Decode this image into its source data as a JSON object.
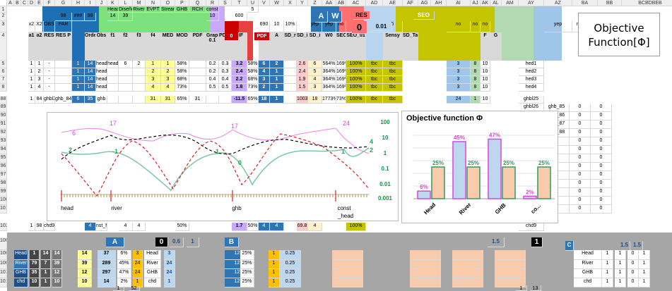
{
  "sheet": {
    "col_headers": [
      "A",
      "B",
      "C",
      "D",
      "E",
      "F",
      "G",
      "H",
      "I",
      "J",
      "K",
      "L",
      "M",
      "N",
      "O",
      "P",
      "Q",
      "R",
      "S",
      "T",
      "U",
      "V",
      "W",
      "X",
      "Y",
      "Z",
      "AA",
      "AB",
      "AC",
      "AD",
      "AE",
      "AF",
      "AG",
      "AH",
      "AI",
      "AJ",
      "AK",
      "AL",
      "AM",
      "AY",
      "AZ",
      "BA",
      "BB",
      "BCBDBEB"
    ],
    "row_headers": [
      "1",
      "2",
      "3",
      "4",
      "5",
      "6",
      "7",
      "8",
      "88",
      "89",
      "90",
      "91",
      "92",
      "93",
      "94",
      "95",
      "96",
      "97",
      "98",
      "99",
      "100",
      "101",
      "102",
      "1003",
      "1004",
      "1009",
      "1012",
      "1014"
    ],
    "header_rows": {
      "r1": [
        "",
        "",
        "",
        "",
        "",
        "",
        "",
        "Head",
        "Diseño",
        "River",
        "EVPT",
        "Streams",
        "GHB",
        "RCH",
        "const_head",
        "",
        "",
        "5",
        "",
        "",
        "",
        "",
        "",
        "",
        "",
        "",
        "",
        "",
        "",
        "",
        "",
        "",
        "",
        "",
        "",
        "",
        "",
        "",
        ""
      ],
      "r2": [
        "",
        "",
        "",
        "98",
        "###",
        "98",
        "",
        "14",
        "39",
        "",
        "",
        "",
        "",
        "",
        "10",
        "",
        "600",
        "",
        "",
        "",
        "",
        "",
        "",
        "",
        "",
        "",
        "",
        "",
        "",
        "",
        "",
        "",
        "",
        "",
        "",
        "",
        "",
        "",
        ""
      ],
      "r3": [
        "x2",
        "X2",
        "OBS",
        "PAR",
        "",
        "",
        "",
        "",
        "",
        "",
        "",
        "",
        "",
        "",
        "",
        "",
        "",
        "",
        "690",
        "10",
        "10%",
        "",
        "yep",
        "yep",
        "no",
        "yep",
        "no",
        "5",
        "",
        "",
        "",
        "no",
        "no",
        "no",
        "",
        "",
        "",
        "yep",
        "no"
      ],
      "r4": [
        "a1",
        "a2",
        "RES",
        "RES P",
        "",
        "Order",
        "Obs",
        "f1",
        "f2",
        "f3",
        "f4",
        "MED",
        "MOD",
        "PDF",
        "Graph 0.1",
        "PDFa",
        "DIF",
        "",
        "A",
        "A",
        "SD_r",
        "SD_i",
        "SD_i",
        "W0",
        "SEO",
        "SEO_01",
        "",
        "Sensy",
        "SD_Tab",
        "",
        "",
        "",
        "",
        "F",
        "G",
        "",
        "",
        ""
      ]
    },
    "top_labels": {
      "a_label": "A",
      "w_label": "W",
      "res_label": "RES",
      "seo_label": "SEO",
      "sd_label": "SD_i",
      "pdf_label": "PDF",
      "zero_val": "0",
      "yep_val": "0.01",
      "five": "5"
    },
    "rows": [
      {
        "n": "5",
        "d": "1",
        "e": "1",
        "f": "-",
        "g": "",
        "h": "1",
        "i": "14",
        "j": "head",
        "k": "head",
        "l": "6",
        "m": "2",
        "n2": "1",
        "o": "1",
        "p": "58%",
        "q": "",
        "r": "0.2",
        "s": "0.3",
        "t": "3.2",
        "u": "58%",
        "v": "6",
        "w": "2",
        "x": "",
        "y": "2.6",
        "z": "6",
        "aa": "564%",
        "ab": "169%",
        "ac": "100%",
        "ad": "tbc",
        "ae": "tbc",
        "ai": "3",
        "aj": "8",
        "ak": "10",
        "ay": "hed1"
      },
      {
        "n": "6",
        "d": "1",
        "e": "2",
        "f": "-",
        "g": "",
        "h": "1",
        "i": "14",
        "j": "head",
        "k": "",
        "l": "",
        "m": "",
        "n2": "2",
        "o": "2",
        "p": "58%",
        "q": "",
        "r": "0.2",
        "s": "0.3",
        "t": "2.4",
        "u": "58%",
        "v": "4",
        "w": "1",
        "x": "",
        "y": "2.4",
        "z": "5",
        "aa": "364%",
        "ab": "169%",
        "ac": "100%",
        "ad": "tbc",
        "ae": "tbc",
        "ai": "3",
        "aj": "8",
        "ak": "10",
        "ay": "hed2"
      },
      {
        "n": "7",
        "d": "1",
        "e": "3",
        "f": "-",
        "g": "",
        "h": "1",
        "i": "14",
        "j": "head",
        "k": "",
        "l": "",
        "m": "",
        "n2": "3",
        "o": "3",
        "p": "68%",
        "q": "",
        "r": "0.4",
        "s": "0.4",
        "t": "2.2",
        "u": "68%",
        "v": "3",
        "w": "1",
        "x": "",
        "y": "1.9",
        "z": "4",
        "aa": "364%",
        "ab": "169%",
        "ac": "100%",
        "ad": "tbc",
        "ae": "tbc",
        "ai": "3",
        "aj": "8",
        "ak": "10",
        "ay": "hed3"
      },
      {
        "n": "8",
        "d": "1",
        "e": "4",
        "f": "-",
        "g": "",
        "h": "1",
        "i": "14",
        "j": "head",
        "k": "",
        "l": "",
        "m": "",
        "n2": "4",
        "o": "4",
        "p": "73%",
        "q": "",
        "r": "0.5",
        "s": "0.5",
        "t": "1.8",
        "u": "73%",
        "v": "2",
        "w": "1",
        "x": "",
        "y": "1.5",
        "z": "3",
        "aa": "364%",
        "ab": "169%",
        "ac": "100%",
        "ad": "tbc",
        "ae": "tbc",
        "ai": "3",
        "aj": "8",
        "ak": "10",
        "ay": "hed4"
      },
      {
        "n": "88",
        "d": "1",
        "e": "84",
        "f": "ghbl25",
        "g": "ghb_84",
        "h": "6",
        "i": "35",
        "j": "ghb",
        "k": "",
        "l": "",
        "m": "",
        "n2": "31",
        "o": "31",
        "p": "65%",
        "q": "31",
        "r": "",
        "s": "",
        "t": "-11.5",
        "u": "65%",
        "v": "18",
        "w": "1",
        "x": "",
        "y": "1003.1",
        "z": "18",
        "aa": "1773%",
        "ab": "73%",
        "ac": "100%",
        "ad": "tbc",
        "ae": "tbc",
        "ai": "24",
        "aj": "1",
        "ak": "10",
        "ay": "ghbl25"
      }
    ],
    "side_rows": [
      {
        "n": "89",
        "ay": "ghbl26",
        "az": "ghb_85"
      },
      {
        "n": "90",
        "ay": "ghbl27",
        "az": "ghb_86"
      },
      {
        "n": "91",
        "ay": "ghbl28",
        "az": "ghb_87"
      },
      {
        "n": "92",
        "ay": "ghbl29",
        "az": "ghb_88"
      },
      {
        "n": "93",
        "ay": "chd1",
        "az": ""
      },
      {
        "n": "94",
        "ay": "chd2",
        "az": ""
      },
      {
        "n": "95",
        "ay": "chd3",
        "az": ""
      },
      {
        "n": "96",
        "ay": "chd4",
        "az": ""
      },
      {
        "n": "97",
        "ay": "chd5",
        "az": ""
      },
      {
        "n": "98",
        "ay": "chd6",
        "az": ""
      },
      {
        "n": "99",
        "ay": "chd7",
        "az": ""
      },
      {
        "n": "100",
        "ay": "chd8",
        "az": ""
      },
      {
        "n": "101",
        "ay": "chd9",
        "az": ""
      }
    ],
    "row102": {
      "n": "102",
      "d": "1",
      "e": "98",
      "f": "chd9",
      "i": "4",
      "j": "nst_he",
      "l": "4",
      "m": "4",
      "p": "50%",
      "t": "1.7",
      "u": "50%",
      "v": "4",
      "w": "4",
      "y": "69.8",
      "z": "4",
      "ac": "100%",
      "ay": "chd9"
    },
    "bottom": {
      "r1003": {
        "a": "A",
        "one": "1",
        "zero": "0",
        "x06": "0.6",
        "one2": "1",
        "b": "B",
        "c15": "1.5",
        "one3": "1",
        "c": "C",
        "x15": "1.5",
        "x15b": "1.5"
      },
      "legend_rows": [
        {
          "n": "1004",
          "lbl": "Head",
          "col": "#1f4e8c",
          "a": "1",
          "b": "14",
          "c": "14",
          "d": "37",
          "e": "6%",
          "f": "3",
          "g": "Head",
          "h": "3",
          "tot": "14"
        },
        {
          "n": "1009",
          "lbl": "River",
          "col": "#2e75b6",
          "a": "79",
          "b": "7",
          "c": "39",
          "d": "289",
          "e": "45%",
          "f": "24",
          "g": "River",
          "h": "24",
          "tot": "39"
        },
        {
          "n": "1012",
          "lbl": "GHB",
          "col": "#1f4e8c",
          "a": "35",
          "b": "1",
          "c": "12",
          "d": "297",
          "e": "47%",
          "f": "24",
          "g": "GHB",
          "h": "24",
          "tot": "12"
        },
        {
          "n": "1014",
          "lbl": "chd",
          "col": "#1f4e8c",
          "a": "10",
          "b": "1",
          "c": "10",
          "d": "14",
          "e": "2%",
          "f": "1",
          "g": "chd",
          "h": "1",
          "tot": "10"
        }
      ],
      "totals": {
        "a": "1",
        "b": "52",
        "x": "1",
        "y": "13"
      }
    }
  },
  "objective_panel": {
    "line1": "Objective",
    "line2": "Function[Φ]"
  },
  "line_chart": {
    "x_labels": [
      "head",
      "river",
      "ghb",
      "const\n_head"
    ],
    "y_right": [
      "100",
      "10",
      "1",
      "0.1",
      "0.01",
      "0.001"
    ],
    "point_labels": [
      {
        "t": "6",
        "c": "#e040e0"
      },
      {
        "t": "17",
        "c": "#e040e0"
      },
      {
        "t": "2",
        "c": "#2e9e5b"
      },
      {
        "t": "-1",
        "c": "#2e9e5b"
      },
      {
        "t": "17",
        "c": "#e040e0"
      },
      {
        "t": "1",
        "c": "#2e9e5b"
      },
      {
        "t": "0",
        "c": "#2e9e5b"
      },
      {
        "t": "24",
        "c": "#e040e0"
      },
      {
        "t": "1",
        "c": "#2e9e5b"
      },
      {
        "t": "4",
        "c": "#2e9e5b"
      },
      {
        "t": "2",
        "c": "#2e9e5b"
      }
    ],
    "colors": {
      "pink": "#e983e9",
      "green": "#7bc8a4",
      "red": "#d62020",
      "black": "#000000",
      "axis_text": "#1a8f4a"
    }
  },
  "chart_data": {
    "type": "bar",
    "title": "Objective function Φ",
    "categories": [
      "Head",
      "River",
      "GHB",
      "co..."
    ],
    "series": [
      {
        "name": "",
        "values": [
          6,
          45,
          47,
          2
        ],
        "labels": [
          "6%",
          "45%",
          "47%",
          "2%"
        ],
        "color": "#bdd7ee",
        "border": "#e040e0"
      },
      {
        "name": "",
        "values": [
          25,
          25,
          25,
          25
        ],
        "labels": [
          "25%",
          "25%",
          "25%",
          "25%"
        ],
        "color": "#f8cbad",
        "border": "#2e9e5b"
      }
    ],
    "ylim": [
      0,
      50
    ]
  }
}
